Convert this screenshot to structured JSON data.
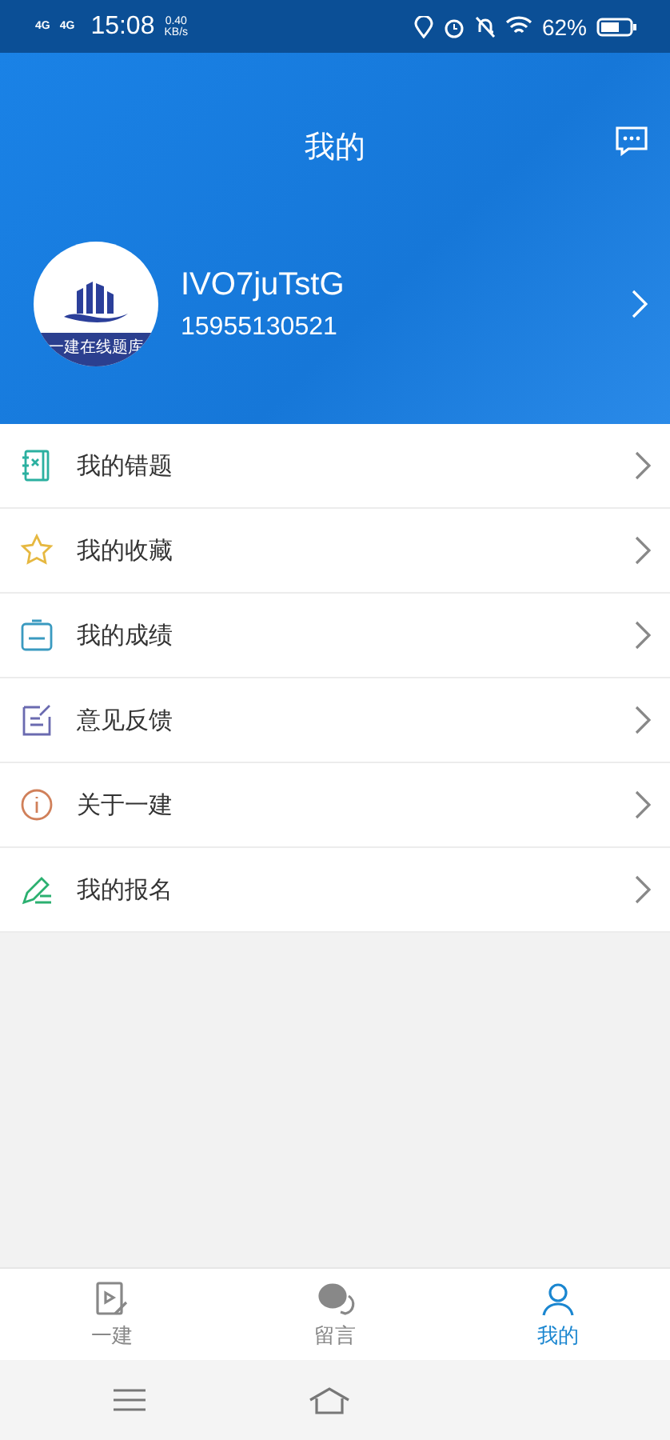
{
  "status_bar": {
    "network": [
      "4G",
      "4G"
    ],
    "time": "15:08",
    "speed_value": "0.40",
    "speed_unit": "KB/s",
    "battery": "62%"
  },
  "header": {
    "title": "我的"
  },
  "profile": {
    "avatar_caption": "一建在线题库",
    "username": "IVO7juTstG",
    "phone": "15955130521"
  },
  "menu": [
    {
      "kind": "wrong",
      "label": "我的错题"
    },
    {
      "kind": "favorite",
      "label": "我的收藏"
    },
    {
      "kind": "score",
      "label": "我的成绩"
    },
    {
      "kind": "feedback",
      "label": "意见反馈"
    },
    {
      "kind": "about",
      "label": "关于一建"
    },
    {
      "kind": "signup",
      "label": "我的报名"
    }
  ],
  "tab_bar": [
    {
      "kind": "study",
      "label": "一建",
      "selected": false
    },
    {
      "kind": "message",
      "label": "留言",
      "selected": false
    },
    {
      "kind": "profile",
      "label": "我的",
      "selected": true
    }
  ]
}
